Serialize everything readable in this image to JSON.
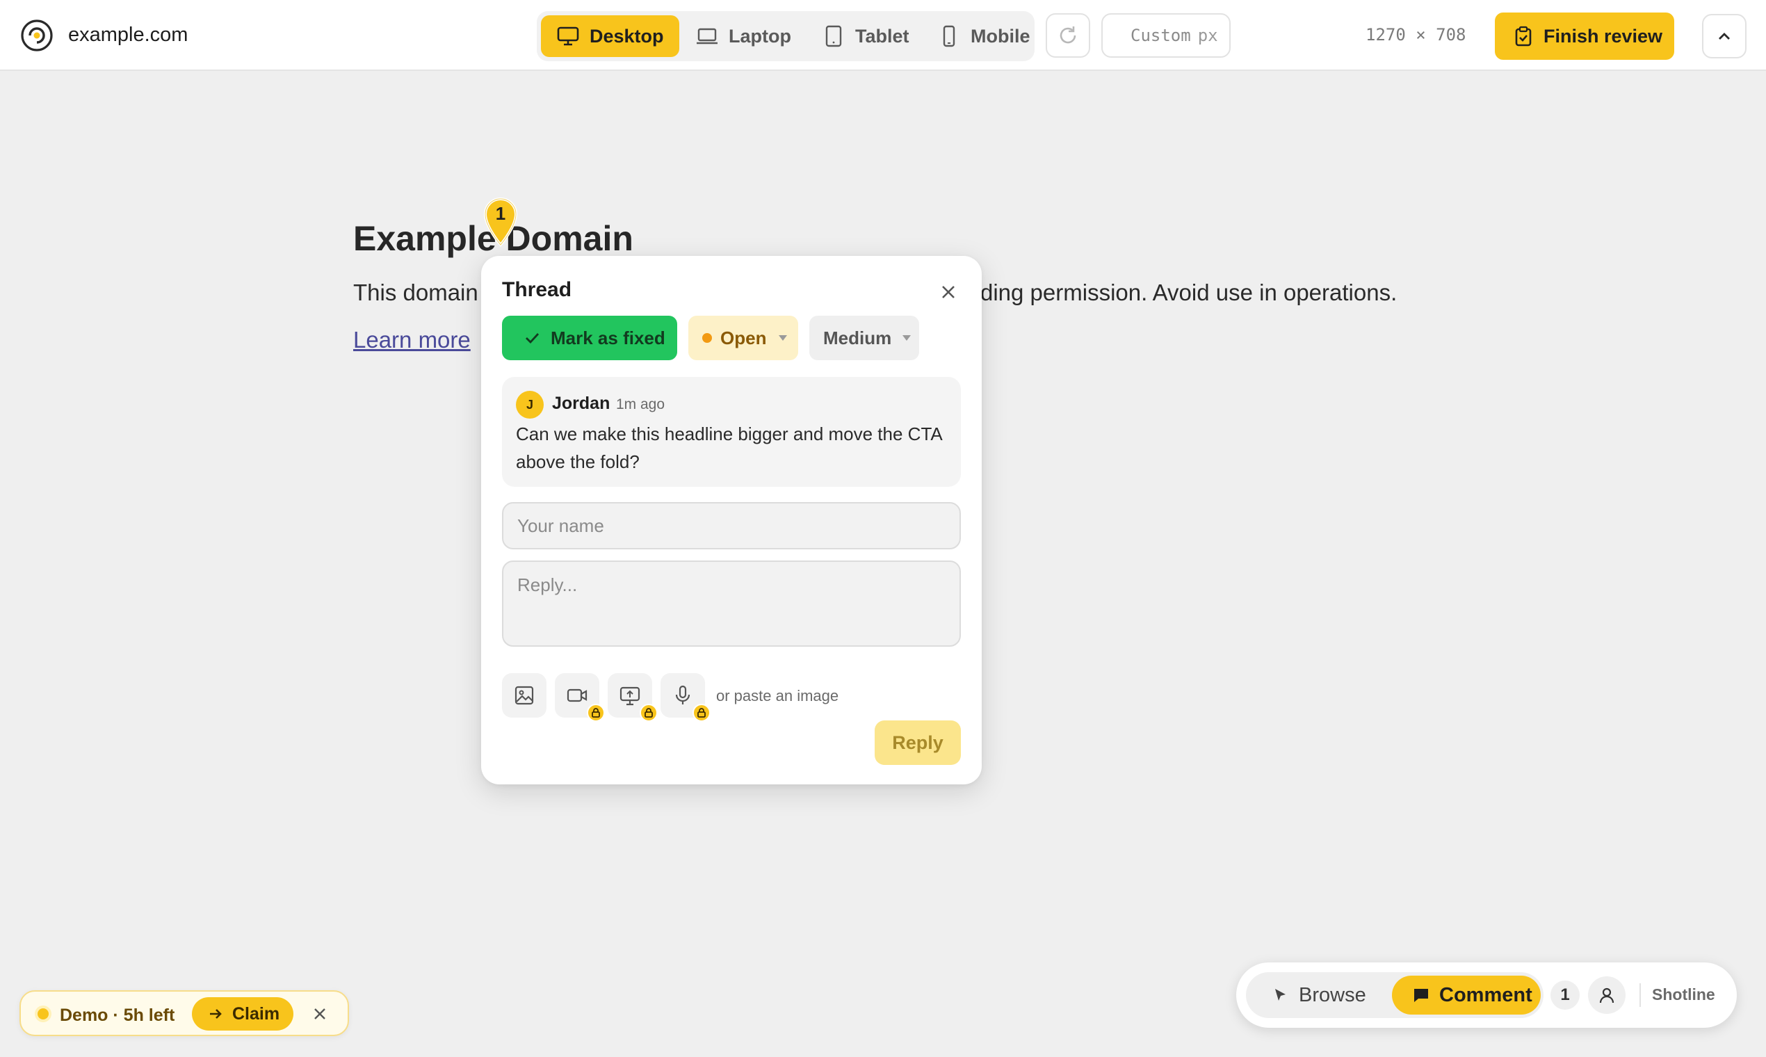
{
  "topbar": {
    "site_name": "example.com",
    "devices": [
      {
        "label": "Desktop",
        "icon": "desktop-icon",
        "active": true
      },
      {
        "label": "Laptop",
        "icon": "laptop-icon",
        "active": false
      },
      {
        "label": "Tablet",
        "icon": "tablet-icon",
        "active": false
      },
      {
        "label": "Mobile",
        "icon": "mobile-icon",
        "active": false
      }
    ],
    "custom_placeholder": "Custom",
    "custom_unit": "px",
    "viewport_size": "1270 × 708",
    "finish_label": "Finish review"
  },
  "page": {
    "heading": "Example Domain",
    "text_start": "This domain",
    "text_end": "ding permission. Avoid use in operations.",
    "link": "Learn more"
  },
  "pin": {
    "number": "1"
  },
  "thread": {
    "title": "Thread",
    "mark_fixed_label": "Mark as fixed",
    "status": "Open",
    "priority": "Medium",
    "comment": {
      "avatar_initial": "J",
      "author": "Jordan",
      "time": "1m ago",
      "text": "Can we make this headline bigger and move the CTA above the fold?"
    },
    "name_placeholder": "Your name",
    "reply_placeholder": "Reply...",
    "paste_hint": "or paste an image",
    "reply_label": "Reply"
  },
  "demo": {
    "label": "Demo · 5h left",
    "claim_label": "Claim"
  },
  "mode_bar": {
    "browse_label": "Browse",
    "comment_label": "Comment",
    "count": "1",
    "brand": "Shotline"
  },
  "colors": {
    "accent": "#f8c41c",
    "success": "#22c55e",
    "open_status": "#f29a12",
    "background": "#efefef"
  }
}
